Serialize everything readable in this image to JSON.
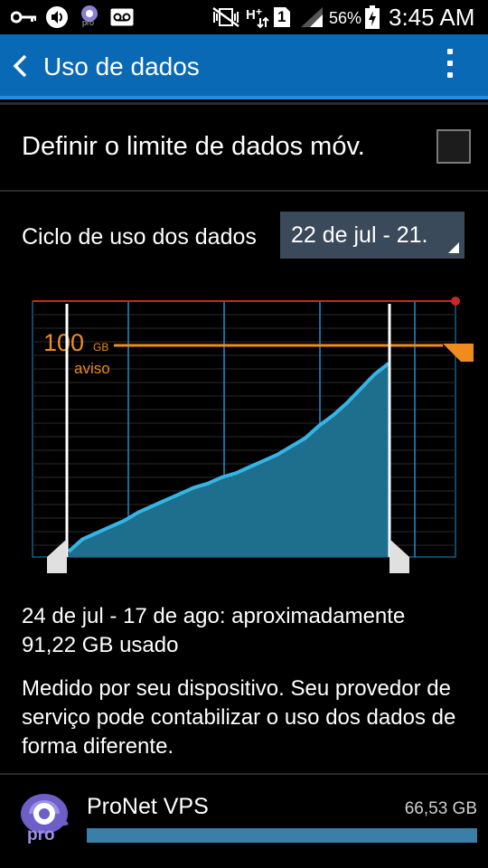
{
  "status_bar": {
    "battery_percent": "56%",
    "time": "3:45 AM",
    "sim_slot": "1",
    "app_badge": "pro",
    "icons": [
      "key-icon",
      "volume-icon",
      "pro-app-icon",
      "voicemail-icon",
      "no-signal-vibrate-icon",
      "hplus-data-icon",
      "sim-1-icon",
      "signal-icon",
      "battery-charging-icon"
    ]
  },
  "action_bar": {
    "title": "Uso de dados",
    "back_icon": "chevron-left-icon",
    "menu_icon": "overflow-menu-icon"
  },
  "limit": {
    "label": "Definir o limite de dados móv.",
    "checked": false
  },
  "cycle": {
    "label": "Ciclo de uso dos dados",
    "selected": "22 de jul - 21."
  },
  "chart_data": {
    "type": "area",
    "warning_value": "100",
    "warning_unit": "GB",
    "warning_label": "aviso",
    "cumulative_usage_gb": [
      0,
      6,
      9,
      12,
      15,
      19,
      22,
      25,
      28,
      31,
      33,
      36,
      38,
      41,
      44,
      47,
      51,
      55,
      61,
      66,
      72,
      79,
      86,
      91.22
    ],
    "colors": {
      "limit_line": "#c62828",
      "warning_line": "#f08c1e",
      "area_fill": "#1e6e8e",
      "line": "#33b5e5",
      "grid": "#1a8fd0"
    }
  },
  "summary": {
    "line1": "24 de jul - 17 de ago: aproximadamente",
    "line2": "91,22 GB usado"
  },
  "note": "Medido por seu dispositivo. Seu provedor de serviço pode contabilizar o uso dos dados de forma diferente.",
  "apps": [
    {
      "name": "ProNet VPS",
      "size": "66,53 GB",
      "badge": "pro",
      "usage_fraction": 1.0
    }
  ]
}
